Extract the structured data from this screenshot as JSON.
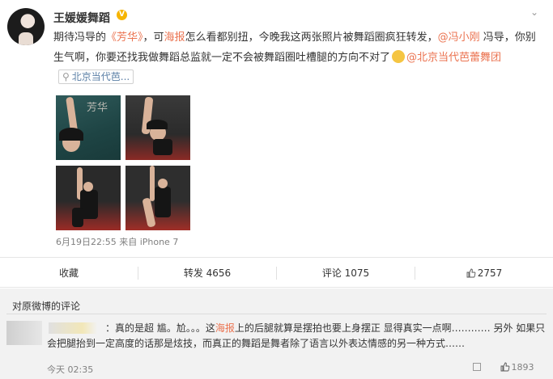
{
  "post": {
    "username": "王媛媛舞蹈",
    "more_glyph": "⌄",
    "content": {
      "p1": "期待冯导的",
      "film": "《芳华》",
      "p2": "，可",
      "poster": "海报",
      "p3": "怎么看都别扭，今晚我这两张照片被舞蹈圈疯狂转发，",
      "mention1": "@冯小刚",
      "p4": " 冯导，你别生气啊，你要还找我做舞蹈总监就一定不会被舞蹈圈吐槽腿的方向不对了",
      "mention2": "@北京当代芭蕾舞团",
      "location": "北京当代芭..."
    },
    "photo_overlay_text": "芳华",
    "meta": "6月19日22:55 来自 iPhone 7"
  },
  "actions": {
    "collect": "收藏",
    "repost": "转发 4656",
    "comment": "评论 1075",
    "like": "2757"
  },
  "comments": {
    "header": "对原微博的评论",
    "item": {
      "p1": "：真的是超 尴。尬。。。这",
      "poster": "海报",
      "p2": "上的后腿就算是摆拍也要上身摆正 显得真实一点啊………… 另外 如果只会把腿抬到一定高度的话那是炫技，而真正的舞蹈是舞者除了语言以外表达情感的另一种方式……",
      "time": "今天 02:35",
      "likes": "1893"
    }
  },
  "colors": {
    "accent": "#eb7350",
    "link": "#5b7fa6",
    "vip": "#f6b400"
  }
}
